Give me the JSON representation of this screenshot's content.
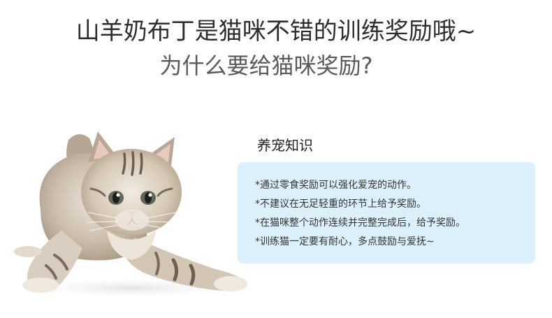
{
  "title": {
    "main": "山羊奶布丁是猫咪不错的训练奖励哦~",
    "sub": "为什么要给猫咪奖励?"
  },
  "knowledge": {
    "heading": "养宠知识",
    "tips": [
      "*通过零食奖励可以强化爱宠的动作。",
      "*不建议在无足轻重的环节上给予奖励。",
      "*在猫咪整个动作连续并完整完成后，给予奖励。",
      "*训练猫一定要有耐心，多点鼓励与爱抚~"
    ]
  },
  "colors": {
    "card_background": "#dcf0fc",
    "title_text": "#2e2e2e",
    "subtitle_text": "#5a5a5a"
  },
  "image": {
    "subject": "tabby kitten crouching"
  }
}
